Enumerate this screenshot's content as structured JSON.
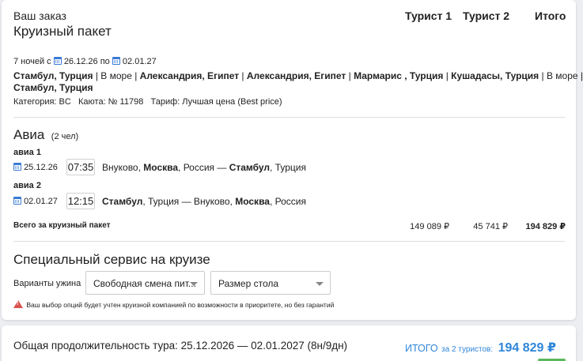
{
  "order": {
    "title_small": "Ваш заказ",
    "title_big": "Круизный пакет",
    "col_tourist1": "Турист 1",
    "col_tourist2": "Турист 2",
    "col_total": "Итого"
  },
  "cruise": {
    "nights_prefix": "7 ночей с",
    "date_from": "26.12.26",
    "date_sep": "по",
    "date_to": "02.01.27",
    "route_line1": [
      {
        "text": "Стамбул, Турция",
        "bold": true
      },
      {
        "text": " | В море | ",
        "bold": false
      },
      {
        "text": "Александрия, Египет",
        "bold": true
      },
      {
        "text": " | ",
        "bold": false
      },
      {
        "text": "Александрия, Египет",
        "bold": true
      },
      {
        "text": " | ",
        "bold": false
      },
      {
        "text": "Мармарис , Турция",
        "bold": true
      },
      {
        "text": " | ",
        "bold": false
      },
      {
        "text": "Кушадасы, Турция",
        "bold": true
      },
      {
        "text": " | В море |",
        "bold": false
      }
    ],
    "route_line2": "Стамбул, Турция",
    "category": "Категория: BC",
    "cabin": "Каюта: № 11798",
    "tariff": "Тариф: Лучшая цена (Best price)"
  },
  "avia": {
    "title": "Авиа",
    "people": "(2 чел)",
    "flights": [
      {
        "label": "авиа 1",
        "date": "25.12.26",
        "time": "07:35",
        "route": [
          {
            "text": "Внуково, ",
            "bold": false
          },
          {
            "text": "Москва",
            "bold": true
          },
          {
            "text": ", Россия — ",
            "bold": false
          },
          {
            "text": "Стамбул",
            "bold": true
          },
          {
            "text": ", Турция",
            "bold": false
          }
        ]
      },
      {
        "label": "авиа 2",
        "date": "02.01.27",
        "time": "12:15",
        "route": [
          {
            "text": "Стамбул",
            "bold": true
          },
          {
            "text": ", Турция — Внуково, ",
            "bold": false
          },
          {
            "text": "Москва",
            "bold": true
          },
          {
            "text": ", Россия",
            "bold": false
          }
        ]
      }
    ],
    "total_label": "Всего за круизный пакет",
    "total_t1": "149 089 ₽",
    "total_t2": "45 741 ₽",
    "total_all": "194 829 ₽"
  },
  "service": {
    "title": "Специальный сервис на круизе",
    "dinner_label": "Варианты ужина",
    "dinner_value": "Свободная смена пит...",
    "table_value": "Размер стола",
    "warning": "Ваш выбор опций будет учтен круизной компанией по возможности в приоритете, но без гарантий"
  },
  "footer": {
    "duration": "Общая продолжительность тура: 25.12.2026 — 02.01.2027 (8н/9дн)",
    "itogo_label": "ИТОГО",
    "itogo_for": "за 2 туристов:",
    "itogo_value": "194 829 ₽"
  },
  "colors": {
    "accent": "#2f86d9",
    "warning": "#d9534f",
    "success": "#5cb85c"
  }
}
